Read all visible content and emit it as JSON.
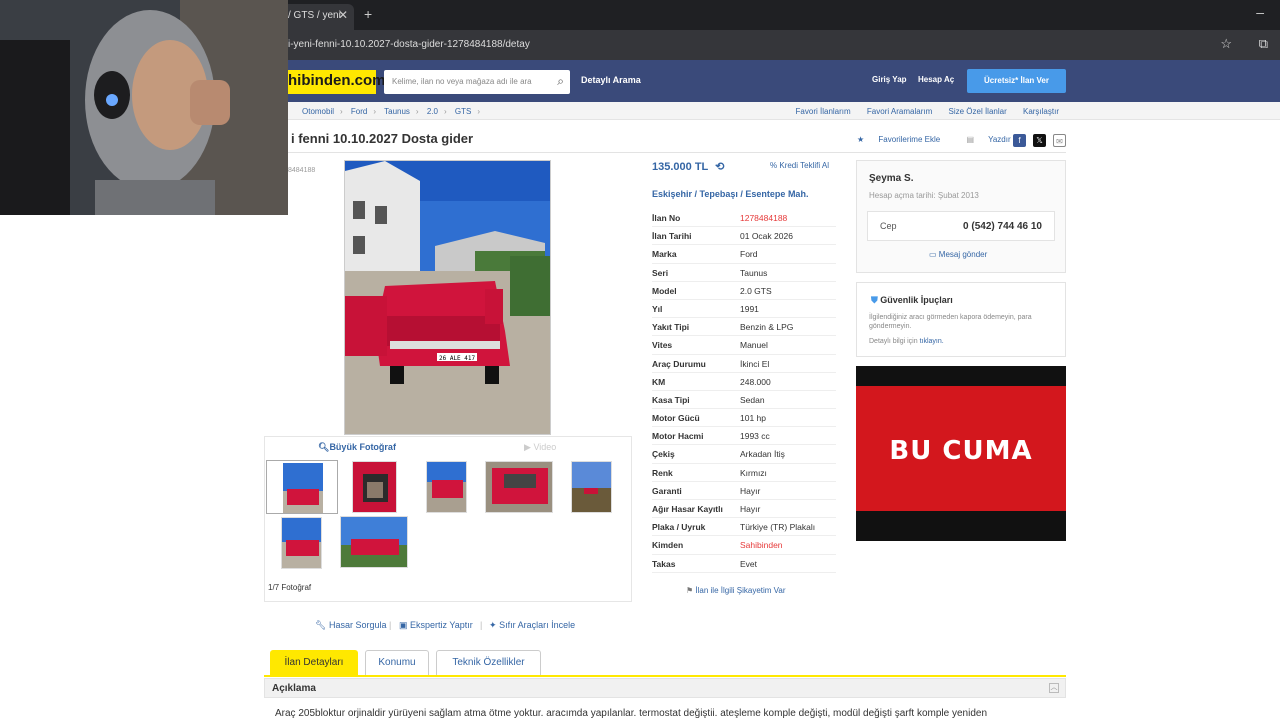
{
  "browser": {
    "tab_title": "/ GTS / yeni",
    "url": "i-yeni-fenni-10.10.2027-dosta-gider-1278484188/detay"
  },
  "header": {
    "logo_text": "hibinden.com",
    "search_placeholder": "Kelime, ilan no veya mağaza adı ile ara",
    "detayli_arama": "Detaylı Arama",
    "giris_yap": "Giriş Yap",
    "hesap_ac": "Hesap Aç",
    "ucretsiz_ilan": "Ücretsiz* İlan Ver"
  },
  "breadcrumb": {
    "items": [
      "Otomobil",
      "Ford",
      "Taunus",
      "2.0",
      "GTS"
    ],
    "right_links": [
      "Favori İlanlarım",
      "Favori Aramalarım",
      "Size Özel İlanlar",
      "Karşılaştır"
    ]
  },
  "listing": {
    "title": "i fenni 10.10.2027 Dosta gider",
    "id_fragment": "8484188",
    "favori": "Favorilerime Ekle",
    "yazdir": "Yazdır",
    "price": "135.000 TL",
    "kredi": "Kredi Teklifi Al",
    "location": [
      "Eskişehir",
      "Tepebaşı",
      "Esentepe Mah."
    ],
    "specs": [
      {
        "k": "İlan No",
        "v": "1278484188",
        "red": true
      },
      {
        "k": "İlan Tarihi",
        "v": "01 Ocak 2026"
      },
      {
        "k": "Marka",
        "v": "Ford"
      },
      {
        "k": "Seri",
        "v": "Taunus"
      },
      {
        "k": "Model",
        "v": "2.0 GTS"
      },
      {
        "k": "Yıl",
        "v": "1991"
      },
      {
        "k": "Yakıt Tipi",
        "v": "Benzin & LPG"
      },
      {
        "k": "Vites",
        "v": "Manuel"
      },
      {
        "k": "Araç Durumu",
        "v": "İkinci El"
      },
      {
        "k": "KM",
        "v": "248.000"
      },
      {
        "k": "Kasa Tipi",
        "v": "Sedan"
      },
      {
        "k": "Motor Gücü",
        "v": "101 hp"
      },
      {
        "k": "Motor Hacmi",
        "v": "1993 cc"
      },
      {
        "k": "Çekiş",
        "v": "Arkadan İtiş"
      },
      {
        "k": "Renk",
        "v": "Kırmızı"
      },
      {
        "k": "Garanti",
        "v": "Hayır"
      },
      {
        "k": "Ağır Hasar Kayıtlı",
        "v": "Hayır"
      },
      {
        "k": "Plaka / Uyruk",
        "v": "Türkiye (TR) Plakalı"
      },
      {
        "k": "Kimden",
        "v": "Sahibinden",
        "red": true
      },
      {
        "k": "Takas",
        "v": "Evet"
      }
    ],
    "sikayet": "İlan ile İlgili Şikayetim Var"
  },
  "photos": {
    "buyuk": "Büyük Fotoğraf",
    "video": "Video",
    "count": "1/7 Fotoğraf",
    "plate": "26 ALE 417"
  },
  "seller": {
    "name": "Şeyma S.",
    "since": "Hesap açma tarihi: Şubat 2013",
    "phone_label": "Cep",
    "phone": "0 (542) 744 46 10",
    "mesaj": "Mesaj gönder"
  },
  "guvenlik": {
    "title": "Güvenlik İpuçları",
    "text": "İlgilendiğiniz aracı görmeden kapora ödemeyin, para göndermeyin.",
    "link_prefix": "Detaylı bilgi için",
    "link": "tıklayın."
  },
  "ad": {
    "text": "BU CUMA"
  },
  "actions": [
    "Hasar Sorgula",
    "Ekspertiz Yaptır",
    "Sıfır Araçları İncele"
  ],
  "tabs": [
    "İlan Detayları",
    "Konumu",
    "Teknik Özellikler"
  ],
  "aciklama": {
    "title": "Açıklama",
    "text": "Araç 205bloktur orjinaldir yürüyeni sağlam atma ötme yoktur. aracımda yapılanlar. termostat değiştii. ateşleme komple değişti, modül değişti şarft komple yeniden"
  },
  "colors": {
    "brand_yellow": "#ffe800",
    "header_blue": "#3a4a7a",
    "link_blue": "#3566a5",
    "accent_red": "#e63a3a"
  }
}
